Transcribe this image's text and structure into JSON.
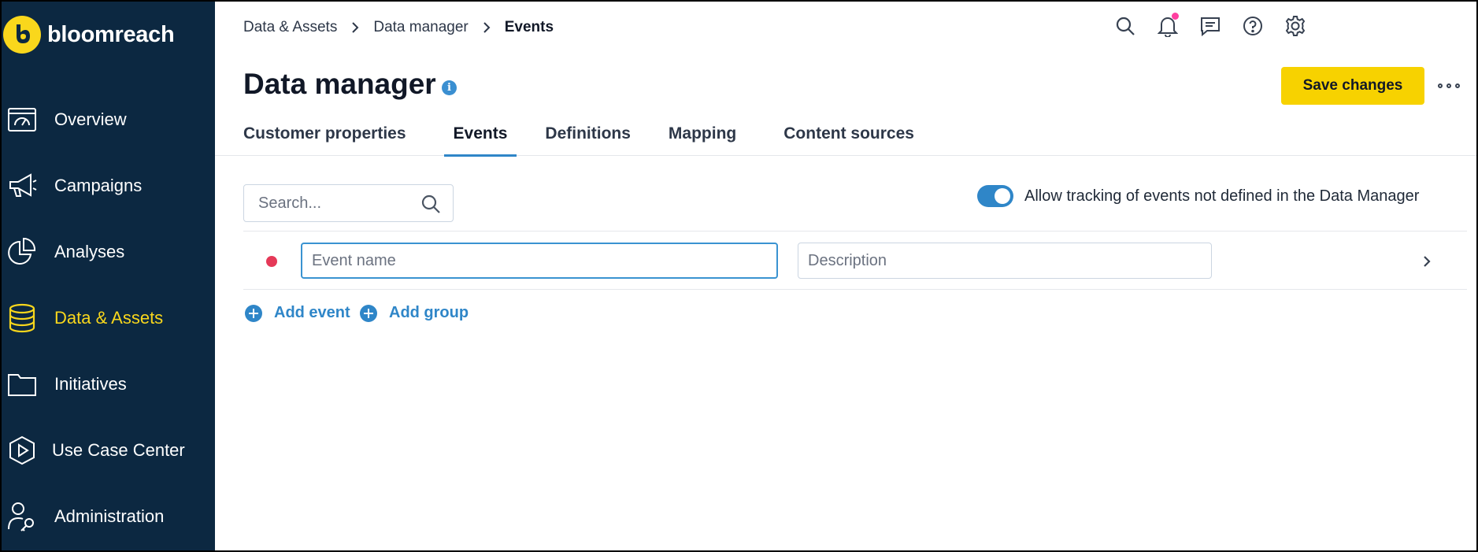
{
  "app": {
    "logo_text": "bloomreach"
  },
  "sidebar": {
    "items": [
      {
        "label": "Overview",
        "icon": "dashboard-icon"
      },
      {
        "label": "Campaigns",
        "icon": "megaphone-icon"
      },
      {
        "label": "Analyses",
        "icon": "pie-chart-icon"
      },
      {
        "label": "Data & Assets",
        "icon": "database-icon",
        "active": true
      },
      {
        "label": "Initiatives",
        "icon": "folder-icon"
      },
      {
        "label": "Use Case Center",
        "icon": "play-hexagon-icon"
      },
      {
        "label": "Administration",
        "icon": "user-key-icon"
      }
    ]
  },
  "breadcrumb": {
    "items": [
      "Data & Assets",
      "Data manager",
      "Events"
    ]
  },
  "header": {
    "title": "Data manager",
    "save_label": "Save changes",
    "icons": [
      "search-icon",
      "bell-icon",
      "chat-icon",
      "help-icon",
      "gear-icon"
    ]
  },
  "tabs": [
    {
      "label": "Customer properties"
    },
    {
      "label": "Events",
      "active": true
    },
    {
      "label": "Definitions"
    },
    {
      "label": "Mapping"
    },
    {
      "label": "Content sources"
    }
  ],
  "search": {
    "placeholder": "Search...",
    "value": ""
  },
  "tracking_toggle": {
    "label": "Allow tracking of events not defined in the Data Manager",
    "on": true
  },
  "event_row": {
    "name_placeholder": "Event name",
    "name_value": "",
    "description_placeholder": "Description",
    "description_value": ""
  },
  "actions": {
    "add_event": "Add event",
    "add_group": "Add group"
  },
  "colors": {
    "sidebar_bg": "#0c2841",
    "brand_yellow": "#f9d71c",
    "accent_blue": "#2f86c8",
    "status_red": "#e53958"
  }
}
